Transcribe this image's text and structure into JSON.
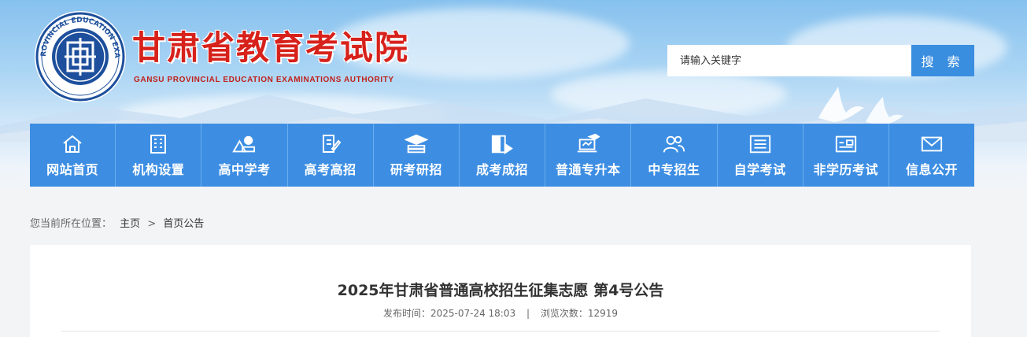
{
  "header": {
    "title_cn": "甘肃省教育考试院",
    "title_en": "GANSU PROVINCIAL EDUCATION EXAMINATIONS AUTHORITY",
    "emblem_text": "甘肃省教育考试院 GANSU PROVINCIAL EDUCATION EXAMINATIONS AUTHORITY",
    "emblem_glyph": "甘"
  },
  "search": {
    "placeholder": "请输入关键字",
    "button_label": "搜 索"
  },
  "nav": {
    "items": [
      {
        "label": "网站首页",
        "icon": "home-icon"
      },
      {
        "label": "机构设置",
        "icon": "building-icon"
      },
      {
        "label": "高中学考",
        "icon": "books-apple-icon"
      },
      {
        "label": "高考高招",
        "icon": "document-pen-icon"
      },
      {
        "label": "研考研招",
        "icon": "graduation-cap-books-icon"
      },
      {
        "label": "成考成招",
        "icon": "book-arrow-icon"
      },
      {
        "label": "普通专升本",
        "icon": "laptop-cap-icon"
      },
      {
        "label": "中专招生",
        "icon": "users-icon"
      },
      {
        "label": "自学考试",
        "icon": "list-icon"
      },
      {
        "label": "非学历考试",
        "icon": "id-card-icon"
      },
      {
        "label": "信息公开",
        "icon": "mail-icon"
      }
    ]
  },
  "breadcrumb": {
    "prefix": "您当前所在位置：",
    "home": "主页",
    "separator": ">",
    "current": "首页公告"
  },
  "article": {
    "title": "2025年甘肃省普通高校招生征集志愿 第4号公告",
    "publish_label": "发布时间：",
    "publish_time": "2025-07-24 18:03",
    "divider": "|",
    "views_label": "浏览次数：",
    "views": "12919"
  },
  "colors": {
    "brand_red": "#d7211b",
    "nav_blue": "#3d8ee3",
    "search_blue": "#3a8ee0",
    "emblem_blue": "#1d4f9c"
  }
}
